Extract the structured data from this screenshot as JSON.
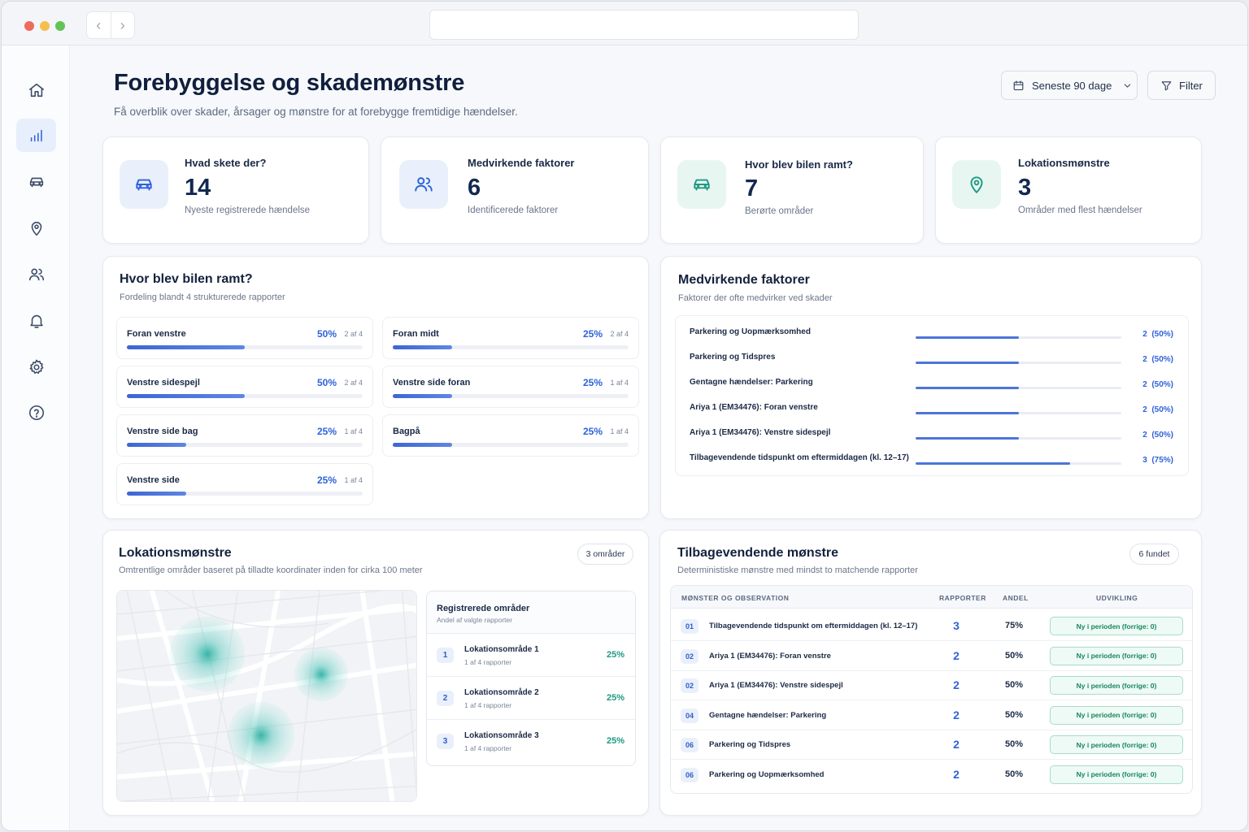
{
  "browser": {
    "url": ""
  },
  "sidebar": {
    "items": [
      {
        "icon": "home-icon"
      },
      {
        "icon": "chart-icon",
        "active": true
      },
      {
        "icon": "car-icon"
      },
      {
        "icon": "location-pin-icon"
      },
      {
        "icon": "users-icon"
      },
      {
        "icon": "bell-icon"
      },
      {
        "icon": "gear-icon"
      },
      {
        "icon": "help-icon"
      }
    ]
  },
  "header": {
    "title": "Forebyggelse og skademønstre",
    "subtitle": "Få overblik over skader, årsager og mønstre for at forebygge fremtidige hændelser.",
    "date_range": "Seneste 90 dage",
    "filter_label": "Filter"
  },
  "kpis": [
    {
      "label": "Hvad skete der?",
      "value": "14",
      "sub": "Nyeste registrerede hændelse",
      "icon": "car-icon",
      "color": "#2f63d9"
    },
    {
      "label": "Medvirkende faktorer",
      "value": "6",
      "sub": "Identificerede faktorer",
      "icon": "users-icon",
      "color": "#2f63d9"
    },
    {
      "label": "Hvor blev bilen ramt?",
      "value": "7",
      "sub": "Berørte områder",
      "icon": "car-icon",
      "color": "#1f9a82"
    },
    {
      "label": "Lokationsmønstre",
      "value": "3",
      "sub": "Områder med flest hændelser",
      "icon": "location-pin-icon",
      "color": "#1f9a82"
    }
  ],
  "hits": {
    "title": "Hvor blev bilen ramt?",
    "subtitle": "Fordeling blandt 4 strukturerede rapporter",
    "items": [
      {
        "label": "Foran venstre",
        "pct": "50%",
        "count": "2 af 4",
        "value": 0.5
      },
      {
        "label": "Foran midt",
        "pct": "25%",
        "count": "2 af 4",
        "value": 0.25
      },
      {
        "label": "Venstre sidespejl",
        "pct": "50%",
        "count": "2 af 4",
        "value": 0.5
      },
      {
        "label": "Venstre side foran",
        "pct": "25%",
        "count": "1 af 4",
        "value": 0.25
      },
      {
        "label": "Venstre side bag",
        "pct": "25%",
        "count": "1 af 4",
        "value": 0.25
      },
      {
        "label": "Bagpå",
        "pct": "25%",
        "count": "1 af 4",
        "value": 0.25
      },
      {
        "label": "Venstre side",
        "pct": "25%",
        "count": "1 af 4",
        "value": 0.25
      }
    ]
  },
  "factors": {
    "title": "Medvirkende faktorer",
    "subtitle": "Faktorer der ofte medvirker ved skader",
    "items": [
      {
        "label": "Parkering og Uopmærksomhed",
        "count": "2",
        "pct": "(50%)",
        "value": 0.5
      },
      {
        "label": "Parkering og Tidspres",
        "count": "2",
        "pct": "(50%)",
        "value": 0.5
      },
      {
        "label": "Gentagne hændelser: Parkering",
        "count": "2",
        "pct": "(50%)",
        "value": 0.5
      },
      {
        "label": "Ariya 1 (EM34476): Foran venstre",
        "count": "2",
        "pct": "(50%)",
        "value": 0.5
      },
      {
        "label": "Ariya 1 (EM34476): Venstre sidespejl",
        "count": "2",
        "pct": "(50%)",
        "value": 0.5
      },
      {
        "label": "Tilbagevendende tidspunkt om eftermiddagen (kl. 12–17)",
        "count": "3",
        "pct": "(75%)",
        "value": 0.75
      }
    ]
  },
  "locations": {
    "title": "Lokationsmønstre",
    "subtitle": "Omtrentlige områder baseret på tilladte koordinater inden for cirka 100 meter",
    "badge": "3 områder",
    "list_title": "Registrerede områder",
    "list_sub": "Andel af valgte rapporter",
    "areas": [
      {
        "num": "1",
        "name": "Lokationsområde 1",
        "sub": "1 af 4 rapporter",
        "pct": "25%"
      },
      {
        "num": "2",
        "name": "Lokationsområde 2",
        "sub": "1 af 4 rapporter",
        "pct": "25%"
      },
      {
        "num": "3",
        "name": "Lokationsområde 3",
        "sub": "1 af 4 rapporter",
        "pct": "25%"
      }
    ]
  },
  "patterns": {
    "title": "Tilbagevendende mønstre",
    "subtitle": "Deterministiske mønstre med mindst to matchende rapporter",
    "badge": "6 fundet",
    "columns": {
      "obs": "MØNSTER OG OBSERVATION",
      "rep": "RAPPORTER",
      "and": "ANDEL",
      "dev": "UDVIKLING"
    },
    "rows": [
      {
        "idx": "01",
        "obs": "Tilbagevendende tidspunkt om eftermiddagen (kl. 12–17)",
        "rep": "3",
        "and": "75%",
        "dev": "Ny i perioden (forrige: 0)"
      },
      {
        "idx": "02",
        "obs": "Ariya 1 (EM34476): Foran venstre",
        "rep": "2",
        "and": "50%",
        "dev": "Ny i perioden (forrige: 0)"
      },
      {
        "idx": "02",
        "obs": "Ariya 1 (EM34476): Venstre sidespejl",
        "rep": "2",
        "and": "50%",
        "dev": "Ny i perioden (forrige: 0)"
      },
      {
        "idx": "04",
        "obs": "Gentagne hændelser: Parkering",
        "rep": "2",
        "and": "50%",
        "dev": "Ny i perioden (forrige: 0)"
      },
      {
        "idx": "06",
        "obs": "Parkering og Tidspres",
        "rep": "2",
        "and": "50%",
        "dev": "Ny i perioden (forrige: 0)"
      },
      {
        "idx": "06",
        "obs": "Parkering og Uopmærksomhed",
        "rep": "2",
        "and": "50%",
        "dev": "Ny i perioden (forrige: 0)"
      }
    ]
  }
}
